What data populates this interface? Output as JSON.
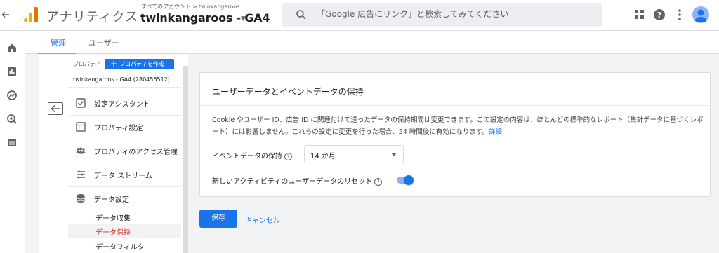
{
  "app": {
    "name": "アナリティクス"
  },
  "breadcrumb": {
    "root": "すべてのアカウント",
    "separator": ">",
    "account": "twinkangaroos"
  },
  "property_selector": {
    "name": "twinkangaroos - GA4"
  },
  "search": {
    "placeholder": "「Google 広告にリンク」と検索してみてください"
  },
  "tabs": [
    {
      "label": "管理",
      "active": true
    },
    {
      "label": "ユーザー",
      "active": false
    }
  ],
  "admin_nav": {
    "property_label": "プロパティ",
    "create_button": "プロパティを作成",
    "property_id": "twinkangaroos - GA4 (280456512)",
    "items": [
      {
        "label": "設定アシスタント",
        "icon": "checkbox-icon"
      },
      {
        "label": "プロパティ設定",
        "icon": "layout-icon"
      },
      {
        "label": "プロパティのアクセス管理",
        "icon": "people-icon"
      },
      {
        "label": "データ ストリーム",
        "icon": "stream-icon"
      },
      {
        "label": "データ設定",
        "icon": "database-icon"
      }
    ],
    "sub_items": [
      {
        "label": "データ収集",
        "active": false
      },
      {
        "label": "データ保持",
        "active": true
      },
      {
        "label": "データフィルタ",
        "active": false
      }
    ]
  },
  "card": {
    "title": "ユーザーデータとイベントデータの保持",
    "description": "Cookie やユーザー ID、広告 ID に関連付けて送ったデータの保持期間は変更できます。この設定の内容は、ほとんどの標準的なレポート（集計データに基づくレポート）には影響しません。これらの設定に変更を行った場合、24 時間後に有効になります。",
    "learn_more": "詳細",
    "event_retention_label": "イベントデータの保持",
    "event_retention_value": "14 か月",
    "reset_label": "新しいアクティビティのユーザーデータのリセット",
    "reset_enabled": true
  },
  "actions": {
    "save": "保存",
    "cancel": "キャンセル"
  },
  "colors": {
    "accent": "#1a73e8",
    "tab_indicator": "#f29900",
    "logo": "#f9ab00",
    "active_subitem": "#d93025"
  }
}
